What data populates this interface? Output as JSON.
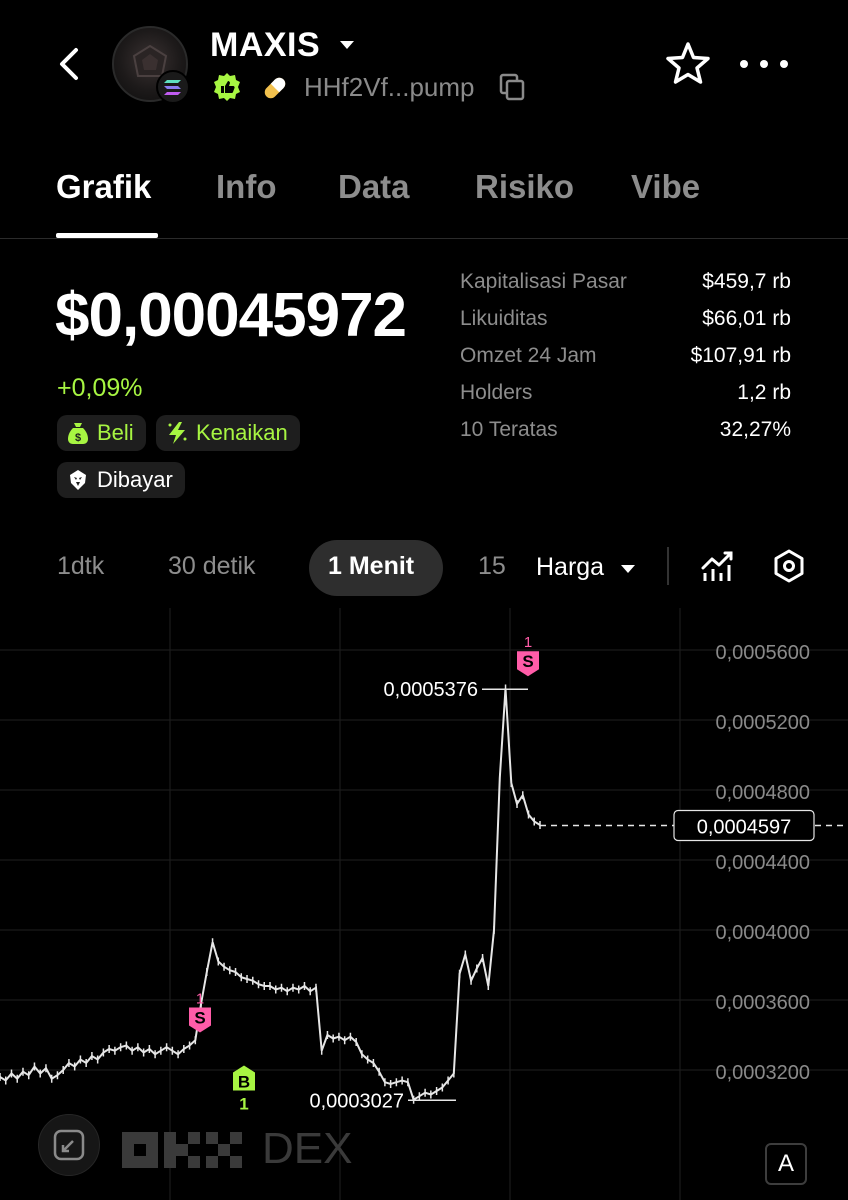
{
  "header": {
    "token_name": "MAXIS",
    "address": "HHf2Vf...pump"
  },
  "tabs": [
    "Grafik",
    "Info",
    "Data",
    "Risiko",
    "Vibe"
  ],
  "price": {
    "value": "$0,00045972",
    "change": "+0,09%"
  },
  "tags": {
    "beli": "Beli",
    "kenaikan": "Kenaikan",
    "dibayar": "Dibayar"
  },
  "stats": [
    {
      "label": "Kapitalisasi Pasar",
      "value": "$459,7 rb"
    },
    {
      "label": "Likuiditas",
      "value": "$66,01 rb"
    },
    {
      "label": "Omzet 24 Jam",
      "value": "$107,91 rb"
    },
    {
      "label": "Holders",
      "value": "1,2 rb"
    },
    {
      "label": "10 Teratas",
      "value": "32,27%"
    }
  ],
  "intervals": {
    "i1": "1dtk",
    "i2": "30 detik",
    "i3": "1 Menit",
    "i4": "15",
    "selected": "1 Menit",
    "mode": "Harga"
  },
  "chart_data": {
    "type": "line",
    "y_ticks": [
      "0,0005600",
      "0,0005200",
      "0,0004800",
      "0,0004400",
      "0,0004000",
      "0,0003600",
      "0,0003200"
    ],
    "y_tick_values": [
      0.00056,
      0.00052,
      0.00048,
      0.00044,
      0.0004,
      0.00036,
      0.00032
    ],
    "current_price_label": "0,0004597",
    "current_price": 0.0004597,
    "max_label": "0,0005376",
    "max_value": 0.0005376,
    "min_label": "0,0003027",
    "min_value": 0.0003027,
    "markers": [
      {
        "type": "S",
        "count": "1",
        "value": 0.000334
      },
      {
        "type": "B",
        "count": "1",
        "value": 0.000326
      },
      {
        "type": "S",
        "count": "1",
        "value": 0.0005376
      }
    ],
    "series": [
      {
        "values": [
          0.000316,
          0.000314,
          0.000318,
          0.000315,
          0.000319,
          0.000317,
          0.000322,
          0.000318,
          0.000321,
          0.000315,
          0.000317,
          0.00032,
          0.000324,
          0.000322,
          0.000326,
          0.000324,
          0.000328,
          0.000326,
          0.00033,
          0.000332,
          0.000331,
          0.000333,
          0.000334,
          0.000331,
          0.000333,
          0.00033,
          0.000332,
          0.000329,
          0.000331,
          0.000333,
          0.000331,
          0.000329,
          0.000332,
          0.000334,
          0.000337,
          0.000358,
          0.000376,
          0.000393,
          0.000382,
          0.000379,
          0.000377,
          0.000376,
          0.000373,
          0.000372,
          0.000371,
          0.000369,
          0.000368,
          0.000368,
          0.000366,
          0.000367,
          0.000365,
          0.000367,
          0.000366,
          0.000368,
          0.000365,
          0.000367,
          0.000331,
          0.00034,
          0.000338,
          0.000339,
          0.000337,
          0.000339,
          0.000336,
          0.000329,
          0.000326,
          0.000324,
          0.000319,
          0.000313,
          0.000312,
          0.000313,
          0.000314,
          0.000313,
          0.000303,
          0.000305,
          0.000307,
          0.000306,
          0.000308,
          0.00031,
          0.000314,
          0.000318,
          0.000375,
          0.000386,
          0.000371,
          0.000378,
          0.000384,
          0.000368,
          0.0004,
          0.000487,
          0.000538,
          0.000484,
          0.000472,
          0.000477,
          0.000466,
          0.000462,
          0.00046
        ]
      }
    ]
  },
  "footer": {
    "dex": "DEX",
    "a_button": "A"
  }
}
